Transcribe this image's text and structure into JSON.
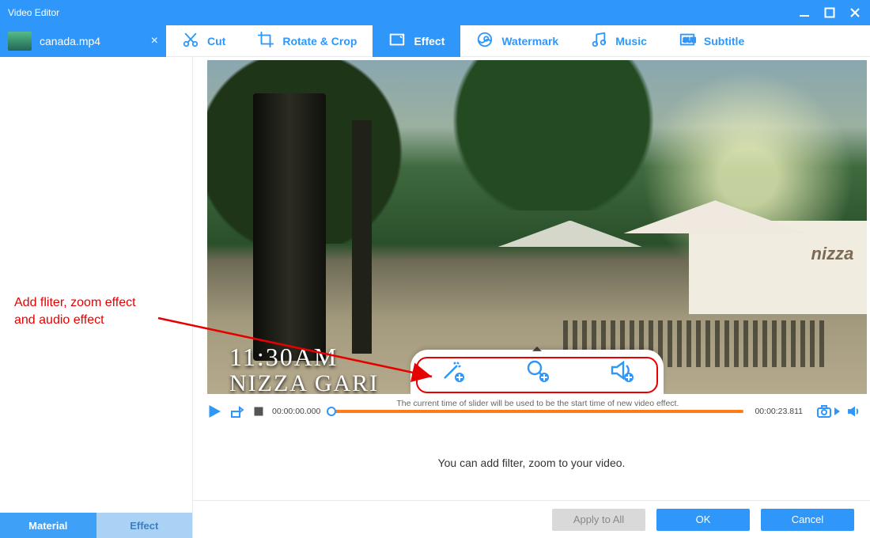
{
  "titlebar": {
    "title": "Video Editor"
  },
  "filetab": {
    "filename": "canada.mp4"
  },
  "tooltabs": [
    {
      "id": "cut",
      "label": "Cut",
      "icon": "cut-icon"
    },
    {
      "id": "rotate",
      "label": "Rotate & Crop",
      "icon": "crop-icon"
    },
    {
      "id": "effect",
      "label": "Effect",
      "icon": "effect-icon",
      "active": true
    },
    {
      "id": "watermark",
      "label": "Watermark",
      "icon": "watermark-icon"
    },
    {
      "id": "music",
      "label": "Music",
      "icon": "music-icon"
    },
    {
      "id": "subtitle",
      "label": "Subtitle",
      "icon": "subtitle-icon"
    }
  ],
  "sidebar": {
    "annotation_l1": "Add fliter, zoom effect",
    "annotation_l2": "and audio effect",
    "tabs": {
      "material": "Material",
      "effect": "Effect"
    },
    "active_tab": "material"
  },
  "preview": {
    "overlay_time": "11:30AM",
    "overlay_place": "NIZZA GARI",
    "building_sign": "nizza"
  },
  "effect_popup": {
    "icons": [
      {
        "name": "magic-wand-plus-icon"
      },
      {
        "name": "zoom-plus-icon"
      },
      {
        "name": "volume-plus-icon"
      }
    ]
  },
  "transport": {
    "time_start": "00:00:00.000",
    "time_end": "00:00:23.811",
    "slider_hint": "The current time of slider will be used to be the start time of new video effect.",
    "slider_pos_pct": 0
  },
  "lower": {
    "hint": "You can add filter, zoom to your video.",
    "buttons": {
      "apply_all": "Apply to All",
      "ok": "OK",
      "cancel": "Cancel"
    }
  },
  "colors": {
    "accent": "#2f97f9",
    "annotation": "#e60000",
    "slider": "#ff7b1a"
  }
}
